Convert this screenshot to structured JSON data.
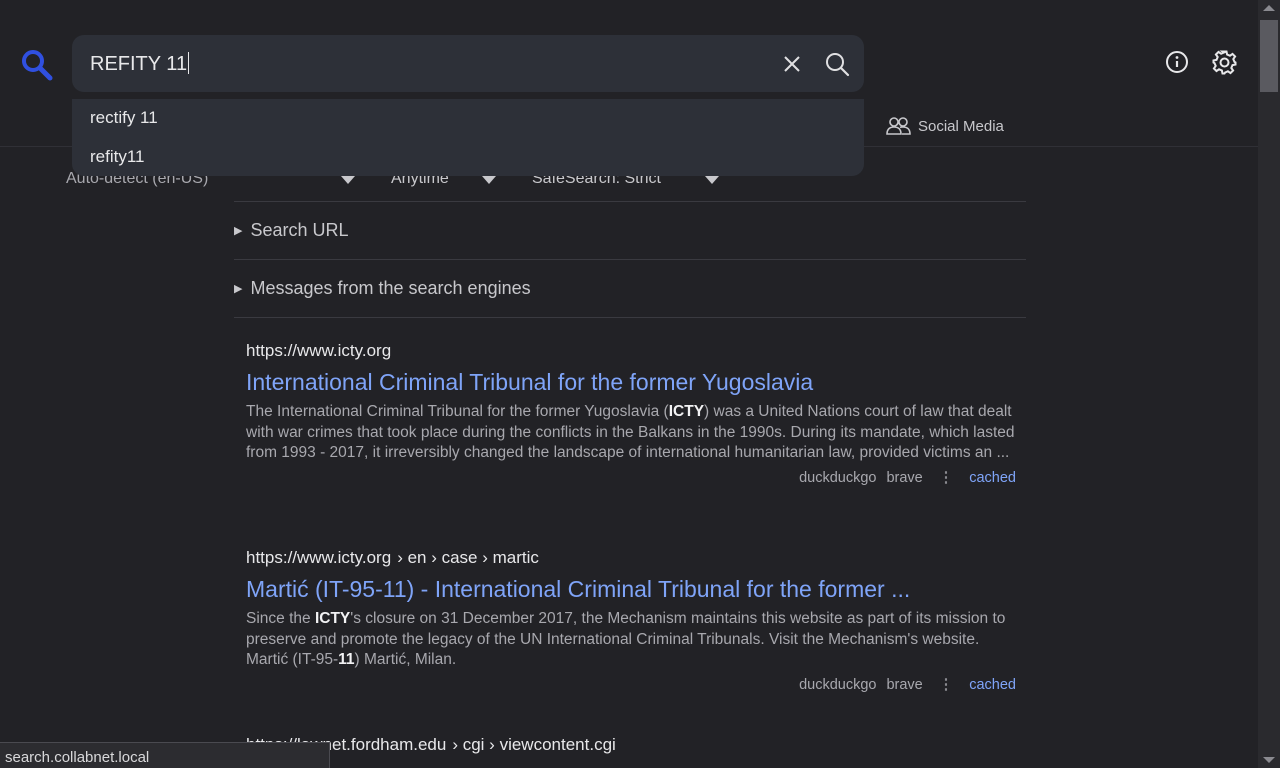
{
  "search": {
    "query": "REFITY 11",
    "suggestions": [
      "rectify 11",
      "refity11"
    ]
  },
  "header": {
    "tabs": [
      {
        "label": "Social Media",
        "icon": "people-icon"
      }
    ]
  },
  "filters": {
    "language": "Auto-detect (en-US)",
    "time": "Anytime",
    "safesearch": "SafeSearch: Strict"
  },
  "details": {
    "search_url": "Search URL",
    "messages": "Messages from the search engines"
  },
  "results": [
    {
      "url_host": "https://www.icty.org",
      "url_path": "",
      "title": "International Criminal Tribunal for the former Yugoslavia",
      "snippet_parts": [
        "The International Criminal Tribunal for the former Yugoslavia (",
        "ICTY",
        ") was a United Nations court of law that dealt with war crimes that took place during the conflicts in the Balkans in the 1990s. During its mandate, which lasted from 1993 - 2017, it irreversibly changed the landscape of international humanitarian law, provided victims an ..."
      ],
      "engines": [
        "duckduckgo",
        "brave"
      ],
      "cached": "cached"
    },
    {
      "url_host": "https://www.icty.org",
      "url_path": "› en › case › martic",
      "title": "Martić (IT-95-11) - International Criminal Tribunal for the former ...",
      "snippet_parts": [
        "Since the ",
        "ICTY",
        "'s closure on 31 December 2017, the Mechanism maintains this website as part of its mission to preserve and promote the legacy of the UN International Criminal Tribunals. Visit the Mechanism's website. Martić (IT-95-",
        "11",
        ") Martić, Milan."
      ],
      "engines": [
        "duckduckgo",
        "brave"
      ],
      "cached": "cached"
    },
    {
      "url_host": "https://lawnet.fordham.edu",
      "url_path": "› cgi › viewcontent.cgi"
    }
  ],
  "status_bar": "search.collabnet.local"
}
